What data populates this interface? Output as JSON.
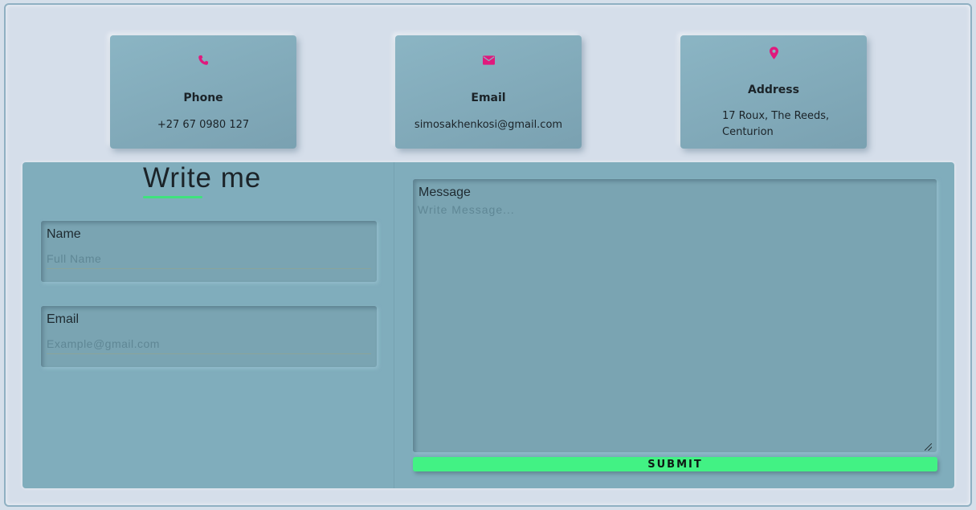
{
  "colors": {
    "icon": "#e0197d",
    "accent": "#42f284",
    "card": "#84adbd",
    "panel": "#80adbc"
  },
  "contact_cards": [
    {
      "icon": "phone-icon",
      "title": "Phone",
      "value": "+27 67 0980 127"
    },
    {
      "icon": "envelope-icon",
      "title": "Email",
      "value": "simosakhenkosi@gmail.com"
    },
    {
      "icon": "map-pin-icon",
      "title": "Address",
      "value_line1": "17 Roux, The Reeds,",
      "value_line2": "Centurion"
    }
  ],
  "form": {
    "heading": "Write me",
    "name": {
      "label": "Name",
      "placeholder": "Full Name",
      "value": ""
    },
    "email": {
      "label": "Email",
      "placeholder": "Example@gmail.com",
      "value": ""
    },
    "message": {
      "label": "Message",
      "placeholder": "Write Message...",
      "value": ""
    },
    "submit_label": "SUBMIT"
  }
}
